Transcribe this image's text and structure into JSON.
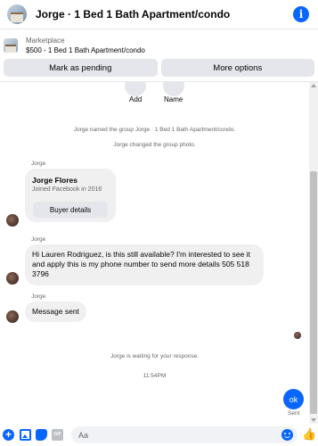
{
  "header": {
    "title": "Jorge · 1 Bed 1 Bath Apartment/condo",
    "info_icon": "i"
  },
  "marketplace": {
    "label": "Marketplace",
    "item": "$500 - 1 Bed 1 Bath Apartment/condo"
  },
  "actions": {
    "pending_label": "Mark as pending",
    "more_label": "More options"
  },
  "chat_top": {
    "add_label": "Add",
    "name_label": "Name"
  },
  "system_messages": {
    "named_group": "Jorge named the group Jorge · 1 Bed 1 Bath Apartment/condo.",
    "changed_photo": "Jorge changed the group photo.",
    "waiting": "Jorge is waiting for your response.",
    "time": "11:54PM"
  },
  "messages": [
    {
      "sender": "Jorge",
      "card": {
        "name": "Jorge Flores",
        "subtitle": "Joined Facebook in 2016",
        "button": "Buyer details"
      }
    },
    {
      "sender": "Jorge",
      "text": "Hi Lauren Rodriguez, is this still available? I'm interested to see it and apply this is my phone number to send more details 505 518 3796"
    },
    {
      "sender": "Jorge",
      "text": "Message sent"
    }
  ],
  "outgoing": {
    "text": "ok",
    "status": "Sent"
  },
  "composer": {
    "placeholder": "Aa",
    "gif_label": "GIF",
    "like_glyph": "👍"
  },
  "colors": {
    "accent": "#0866ff",
    "bubble": "#f0f0f0",
    "secondary_text": "#65676b"
  }
}
